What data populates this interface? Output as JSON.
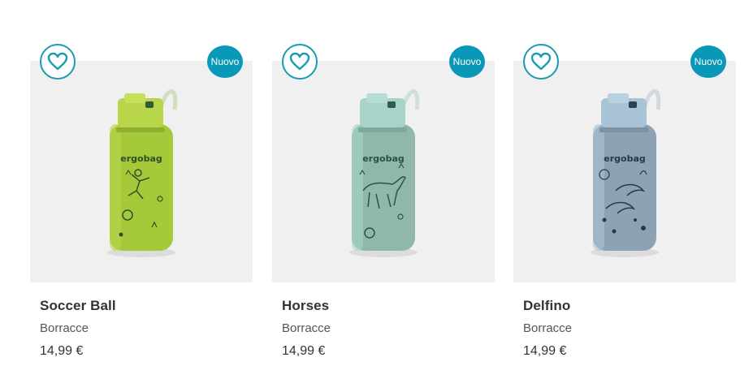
{
  "products": [
    {
      "name": "Soccer Ball",
      "category": "Borracce",
      "price": "14,99 €",
      "badge": "Nuovo",
      "image_icon": "water-bottle-soccer-image",
      "colors": {
        "body": "#a6c93a",
        "cap": "#b9d64a",
        "ring": "#2f5a3a",
        "print": "#2f4f2a"
      }
    },
    {
      "name": "Horses",
      "category": "Borracce",
      "price": "14,99 €",
      "badge": "Nuovo",
      "image_icon": "water-bottle-horses-image",
      "colors": {
        "body": "#8fb8aa",
        "cap": "#a8d3c9",
        "ring": "#2f5a55",
        "print": "#2f4f48"
      }
    },
    {
      "name": "Delfino",
      "category": "Borracce",
      "price": "14,99 €",
      "badge": "Nuovo",
      "image_icon": "water-bottle-dolphin-image",
      "colors": {
        "body": "#8da2b5",
        "cap": "#a9c3d6",
        "ring": "#2e3f52",
        "print": "#2a3848"
      }
    }
  ],
  "theme": {
    "accent": "#1a9cb0",
    "badge_bg": "#0a98b8",
    "image_bg": "#f0f0f0"
  }
}
